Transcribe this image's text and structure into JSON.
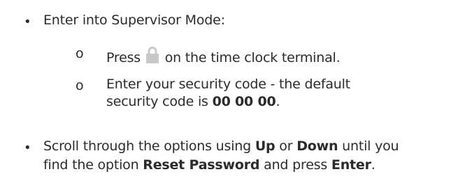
{
  "bullets": [
    {
      "marker": "•",
      "text": "Enter into Supervisor Mode:"
    },
    {
      "marker": "•",
      "line1_pre": "Scroll through the options using ",
      "line1_up": "Up",
      "line1_or": " or ",
      "line1_down": "Down",
      "line1_post": " until you",
      "line2_pre": "find the option ",
      "line2_reset": "Reset Password",
      "line2_mid": " and press ",
      "line2_enter": "Enter",
      "line2_end": "."
    }
  ],
  "sub_items": [
    {
      "marker": "o",
      "text_pre": "Press",
      "icon": "lock-icon",
      "text_post": "on the time clock terminal."
    },
    {
      "marker": "o",
      "line1": "Enter your security code - the default",
      "line2_pre": "security code is ",
      "line2_code": "00 00 00",
      "line2_end": "."
    }
  ],
  "colors": {
    "text": "#2b2b2b",
    "lock_icon": "#c8c8c8"
  }
}
